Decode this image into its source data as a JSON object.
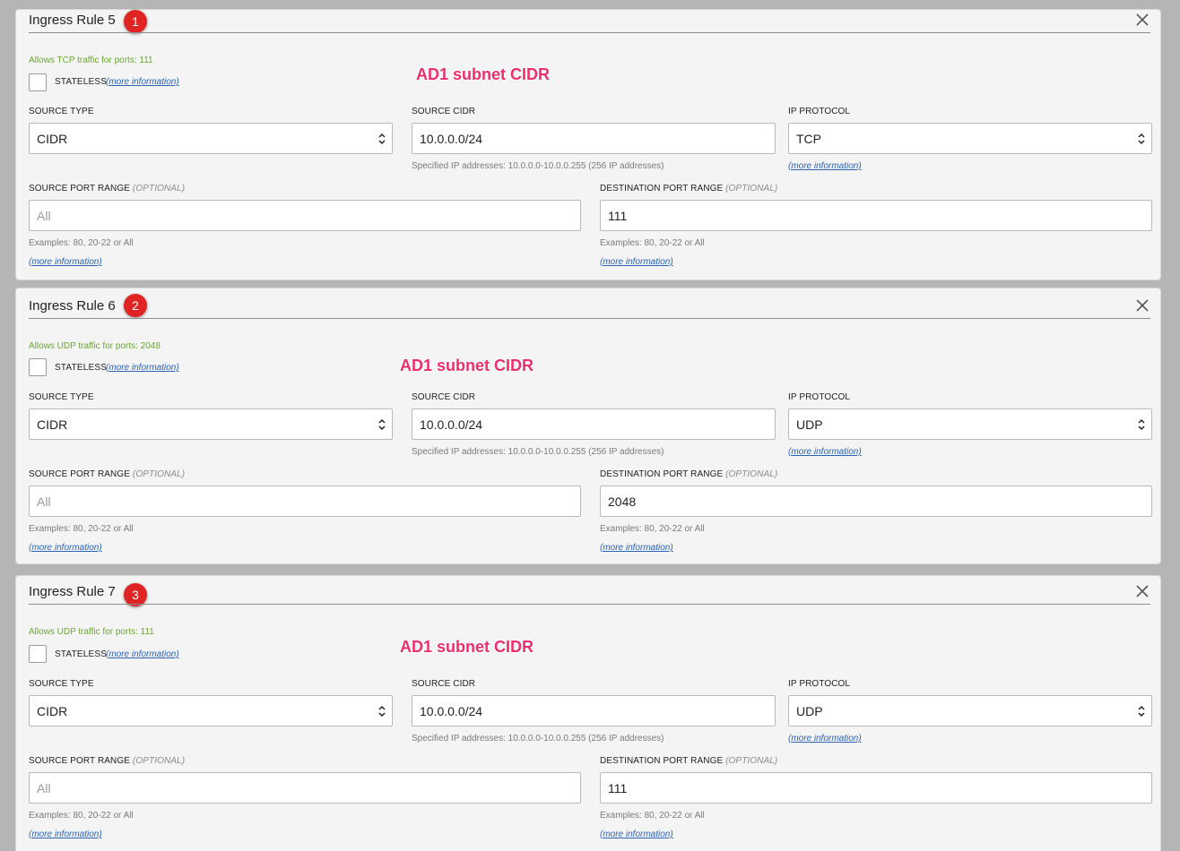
{
  "rules": [
    {
      "title": "Ingress Rule 5",
      "badge": "1",
      "allows": "Allows TCP traffic for ports: 111",
      "stateless_label": "STATELESS",
      "stateless_more": "(more information)",
      "annotation": "AD1 subnet CIDR",
      "source_type_label": "SOURCE TYPE",
      "source_type_value": "CIDR",
      "source_cidr_label": "SOURCE CIDR",
      "source_cidr_value": "10.0.0.0/24",
      "source_cidr_help": "Specified IP addresses: 10.0.0.0-10.0.0.255 (256 IP addresses)",
      "ip_protocol_label": "IP PROTOCOL",
      "ip_protocol_value": "TCP",
      "ip_protocol_more": "(more information)",
      "src_port_label": "SOURCE PORT RANGE",
      "src_port_optional": "(OPTIONAL)",
      "src_port_placeholder": "All",
      "src_port_help": "Examples: 80, 20-22 or All",
      "src_port_more": "(more information)",
      "dst_port_label": "DESTINATION PORT RANGE",
      "dst_port_optional": "(OPTIONAL)",
      "dst_port_value": "111",
      "dst_port_help": "Examples: 80, 20-22 or All",
      "dst_port_more": "(more information)"
    },
    {
      "title": "Ingress Rule 6",
      "badge": "2",
      "allows": "Allows UDP traffic for ports: 2048",
      "stateless_label": "STATELESS",
      "stateless_more": "(more information)",
      "annotation": "AD1 subnet CIDR",
      "source_type_label": "SOURCE TYPE",
      "source_type_value": "CIDR",
      "source_cidr_label": "SOURCE CIDR",
      "source_cidr_value": "10.0.0.0/24",
      "source_cidr_help": "Specified IP addresses: 10.0.0.0-10.0.0.255 (256 IP addresses)",
      "ip_protocol_label": "IP PROTOCOL",
      "ip_protocol_value": "UDP",
      "ip_protocol_more": "(more information)",
      "src_port_label": "SOURCE PORT RANGE",
      "src_port_optional": "(OPTIONAL)",
      "src_port_placeholder": "All",
      "src_port_help": "Examples: 80, 20-22 or All",
      "src_port_more": "(more information)",
      "dst_port_label": "DESTINATION PORT RANGE",
      "dst_port_optional": "(OPTIONAL)",
      "dst_port_value": "2048",
      "dst_port_help": "Examples: 80, 20-22 or All",
      "dst_port_more": "(more information)"
    },
    {
      "title": "Ingress Rule 7",
      "badge": "3",
      "allows": "Allows UDP traffic for ports: 111",
      "stateless_label": "STATELESS",
      "stateless_more": "(more information)",
      "annotation": "AD1 subnet CIDR",
      "source_type_label": "SOURCE TYPE",
      "source_type_value": "CIDR",
      "source_cidr_label": "SOURCE CIDR",
      "source_cidr_value": "10.0.0.0/24",
      "source_cidr_help": "Specified IP addresses: 10.0.0.0-10.0.0.255 (256 IP addresses)",
      "ip_protocol_label": "IP PROTOCOL",
      "ip_protocol_value": "UDP",
      "ip_protocol_more": "(more information)",
      "src_port_label": "SOURCE PORT RANGE",
      "src_port_optional": "(OPTIONAL)",
      "src_port_placeholder": "All",
      "src_port_help": "Examples: 80, 20-22 or All",
      "src_port_more": "(more information)",
      "dst_port_label": "DESTINATION PORT RANGE",
      "dst_port_optional": "(OPTIONAL)",
      "dst_port_value": "111",
      "dst_port_help": "Examples: 80, 20-22 or All",
      "dst_port_more": "(more information)"
    }
  ],
  "colors": {
    "allows_text": "#6aa830",
    "link": "#2a62b8",
    "badge": "#e02424",
    "annotation": "#ec2f6c"
  },
  "icons": {
    "close": "close-icon",
    "select_arrow": "chevron-up-down-icon"
  }
}
